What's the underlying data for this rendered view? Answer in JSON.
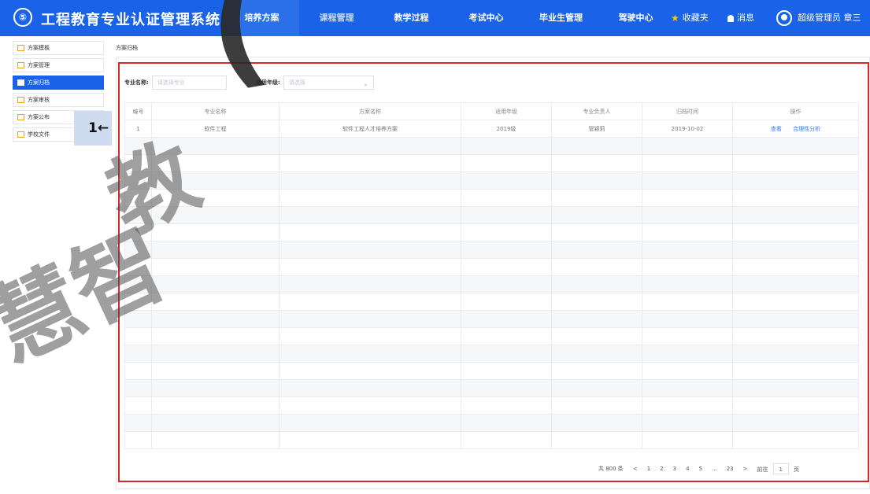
{
  "header": {
    "logo_glyph": "⑤",
    "app_title": "工程教育专业认证管理系统",
    "nav": [
      {
        "label": "培养方案",
        "active": true
      },
      {
        "label": "课程管理",
        "active": false
      },
      {
        "label": "教学过程",
        "active": false
      },
      {
        "label": "考试中心",
        "active": false
      },
      {
        "label": "毕业生管理",
        "active": false
      },
      {
        "label": "驾驶中心",
        "active": false
      }
    ],
    "favorites_label": "收藏夹",
    "messages_label": "消息",
    "user_label": "超级管理员 章三"
  },
  "sidebar": {
    "items": [
      {
        "label": "方案模板",
        "active": false
      },
      {
        "label": "方案管理",
        "active": false
      },
      {
        "label": "方案归档",
        "active": true
      },
      {
        "label": "方案审核",
        "active": false
      },
      {
        "label": "方案公布",
        "active": false
      },
      {
        "label": "学校文件",
        "active": false
      }
    ]
  },
  "callout": {
    "text": "1←"
  },
  "breadcrumb": "方案归档",
  "filters": {
    "major_label": "专业名称:",
    "major_placeholder": "请选择专业",
    "grade_label": "适用年级:",
    "grade_placeholder": "请选择"
  },
  "table": {
    "headers": [
      "编号",
      "专业名称",
      "方案名称",
      "适用年级",
      "专业负责人",
      "归档时间",
      "操作"
    ],
    "rows": [
      {
        "id": "1",
        "major": "软件工程",
        "plan": "软件工程人才培养方案",
        "grade": "2019级",
        "owner": "管颖莉",
        "time": "2019-10-02",
        "actions": [
          "查看",
          "合理性分析"
        ]
      }
    ]
  },
  "pagination": {
    "total": "共 800 条",
    "prev": "<",
    "pages": [
      "1",
      "2",
      "3",
      "4",
      "5",
      "...",
      "23"
    ],
    "next": ">",
    "goto_label": "前往",
    "goto_value": "1",
    "page_suffix": "页"
  },
  "watermark": {
    "line1": "(",
    "line2": "教",
    "line3": "慧智"
  },
  "colors": {
    "header_blue": "#1a63e8",
    "highlight_red": "#d62a2a"
  }
}
